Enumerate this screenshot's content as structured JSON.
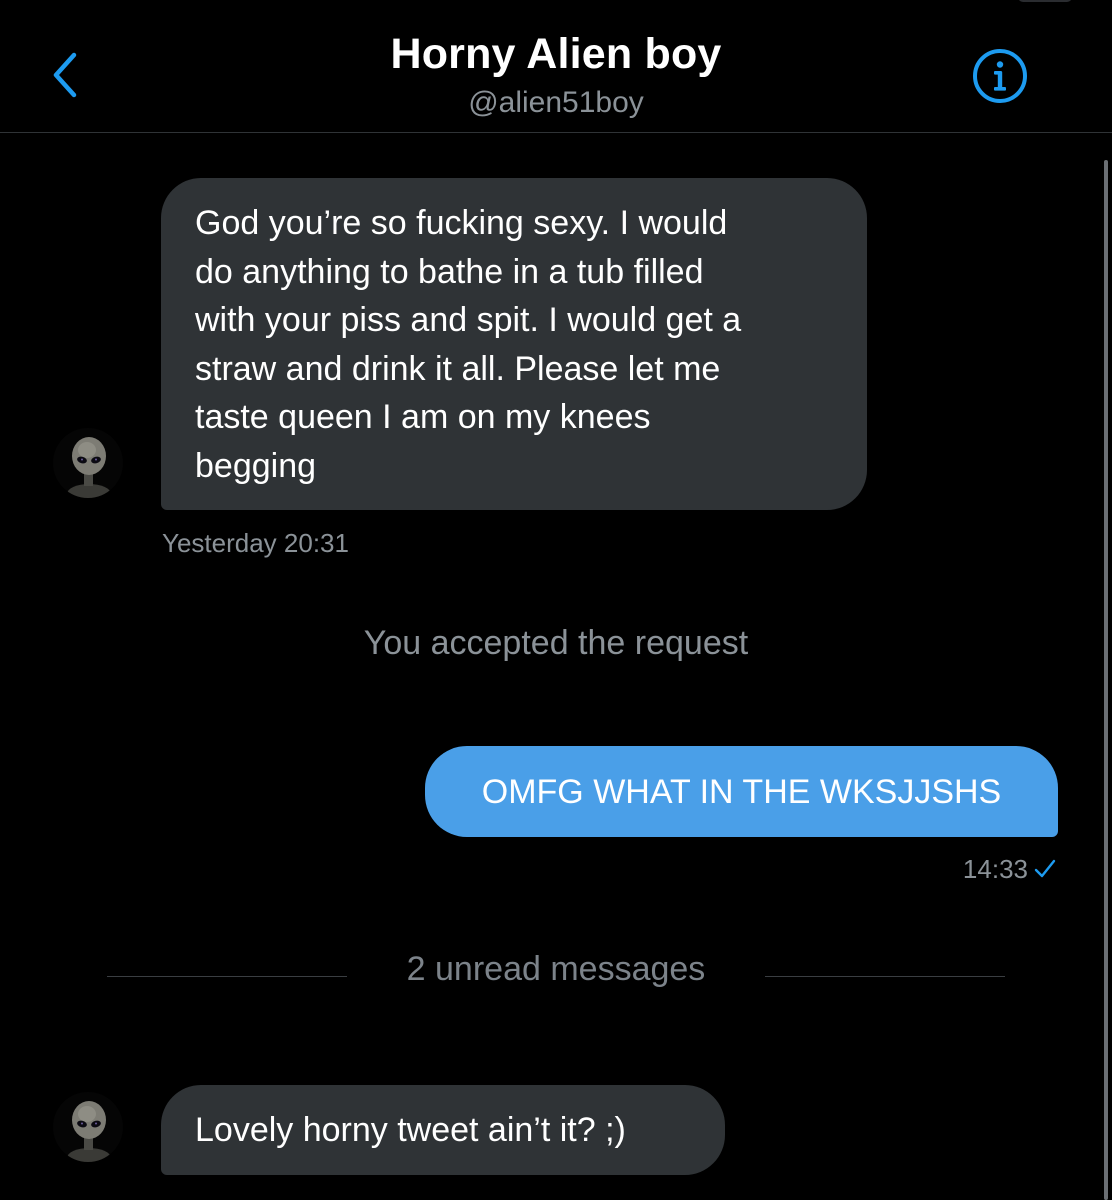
{
  "header": {
    "title": "Horny Alien boy",
    "handle": "@alien51boy",
    "back_icon": "chevron-left-icon",
    "info_icon": "info-circle-icon"
  },
  "messages": [
    {
      "direction": "incoming",
      "text": "God you’re so fucking sexy. I would do anything to bathe in a tub filled with your piss and spit. I would get a straw and drink it all. Please let me taste queen I am on my knees begging",
      "lines": [
        "God you’re so fucking sexy. I would",
        "do anything to bathe in a tub filled",
        "with your piss and spit. I would get a",
        "straw and drink it all. Please let me",
        "taste queen I am on my knees",
        "begging"
      ],
      "timestamp": "Yesterday 20:31"
    },
    {
      "direction": "system",
      "text": "You accepted the request"
    },
    {
      "direction": "outgoing",
      "text": "OMFG WHAT IN THE WKSJJSHS",
      "timestamp": "14:33",
      "status_icon": "checkmark-icon"
    },
    {
      "direction": "divider",
      "text": "2 unread messages"
    },
    {
      "direction": "incoming",
      "text": "Lovely horny tweet ain’t it? ;)"
    }
  ],
  "colors": {
    "background": "#000000",
    "accent": "#1d9bf0",
    "outgoing_bubble": "#4a9fe8",
    "incoming_bubble": "#2f3336",
    "secondary_text": "#8b9298"
  }
}
